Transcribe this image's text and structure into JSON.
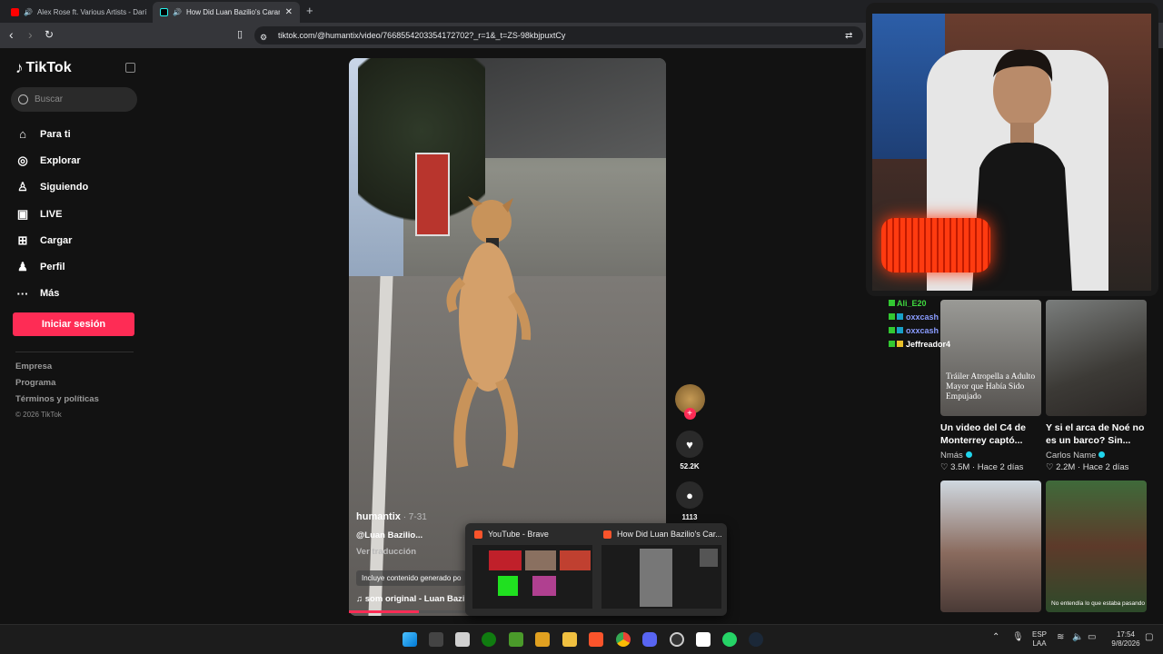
{
  "browser": {
    "tabs": [
      {
        "title": "Alex Rose ft. Various Artists - Darí",
        "active": false
      },
      {
        "title": "How Did Luan Bazilio's Caran",
        "active": true
      }
    ],
    "url": "tiktok.com/@humantix/video/7668554203354172702?_r=1&_t=ZS-98kbjpuxtCy"
  },
  "sidebar": {
    "logo": "TikTok",
    "search_placeholder": "Buscar",
    "items": [
      {
        "label": "Para ti",
        "icon": "home-icon"
      },
      {
        "label": "Explorar",
        "icon": "compass-icon"
      },
      {
        "label": "Siguiendo",
        "icon": "following-icon"
      },
      {
        "label": "LIVE",
        "icon": "live-icon"
      },
      {
        "label": "Cargar",
        "icon": "upload-icon"
      },
      {
        "label": "Perfil",
        "icon": "profile-icon"
      },
      {
        "label": "Más",
        "icon": "more-icon"
      }
    ],
    "login_button": "Iniciar sesión",
    "footer": [
      "Empresa",
      "Programa",
      "Términos y políticas"
    ],
    "copyright": "© 2026 TikTok"
  },
  "video": {
    "author": "humantix",
    "date": "· 7-31",
    "mention": "@Luan Bazilio...",
    "translate": "Ver traducción",
    "ai_label": "Incluye contenido generado po",
    "sound": "som original - Luan Bazil",
    "progress": 0.22,
    "likes": "52.2K",
    "comments": "1113"
  },
  "chat": [
    {
      "user": "Ali_E20"
    },
    {
      "user": "oxxcash"
    },
    {
      "user": "oxxcash"
    },
    {
      "user": "Jeffreador4"
    }
  ],
  "recommendations": [
    {
      "overlay": "Tráiler Atropella a Adulto Mayor que Había Sido Empujado",
      "title": "Un video del C4 de Monterrey captó...",
      "author": "Nmás",
      "views": "3.5M",
      "age": "Hace 2 días"
    },
    {
      "overlay": "",
      "title": "Y si el arca de Noé no es un barco? Sin...",
      "author": "Carlos Name",
      "views": "2.2M",
      "age": "Hace 2 días"
    },
    {
      "overlay": "",
      "title": "",
      "author": "",
      "views": "",
      "age": ""
    },
    {
      "overlay": "No entendía lo que estaba pasando",
      "title": "",
      "author": "",
      "views": "",
      "age": ""
    }
  ],
  "taskbar_popup": {
    "windows": [
      "YouTube - Brave",
      "How Did Luan Bazilio's Car..."
    ]
  },
  "tray": {
    "lang_top": "ESP",
    "lang_bottom": "LAA",
    "time": "17:54",
    "date": "9/8/2026"
  },
  "colors": {
    "accent": "#fe2c55",
    "background": "#121212"
  }
}
